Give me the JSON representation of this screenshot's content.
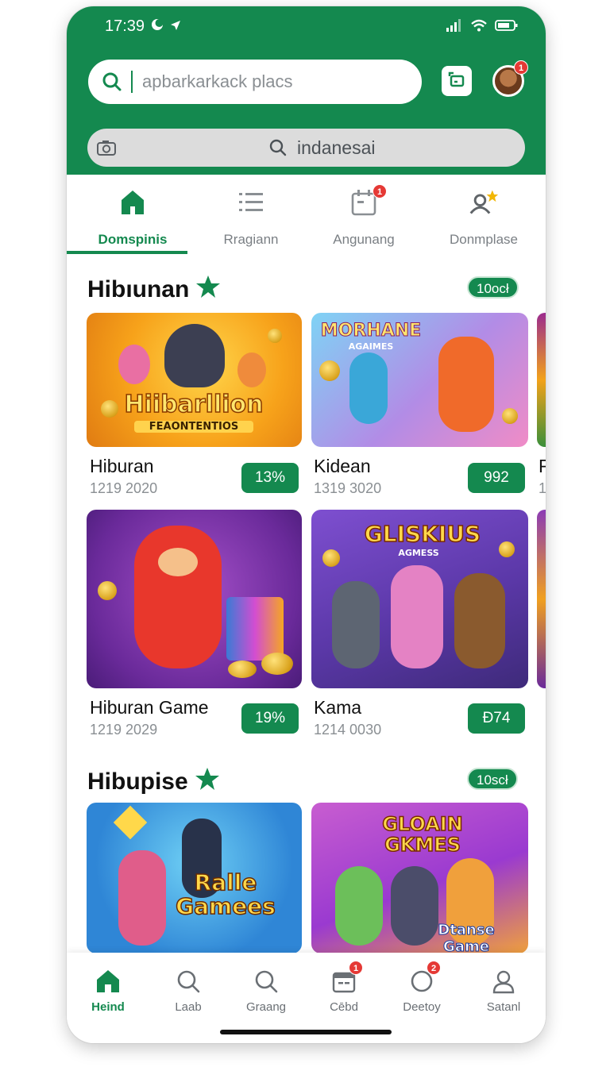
{
  "status_bar": {
    "time": "17:39"
  },
  "search": {
    "placeholder": "apbarkarkack placs"
  },
  "secondary_search": {
    "text": "indanesai"
  },
  "profile": {
    "badge": "1"
  },
  "tabs": [
    {
      "label": "Domspinis",
      "active": true
    },
    {
      "label": "Rragiann",
      "active": false
    },
    {
      "label": "Angunang",
      "active": false,
      "badge": "1"
    },
    {
      "label": "Donmplase",
      "active": false
    }
  ],
  "sections": [
    {
      "title": "Hibıunan",
      "pill": "10ocł",
      "cards": [
        {
          "name": "Hiburan",
          "sub": "1219 2020",
          "pill": "13%",
          "art_title": "Hiibarllion",
          "art_sub": "FEAONTENTIOS"
        },
        {
          "name": "Kidean",
          "sub": "1319 3020",
          "pill": "992",
          "art_title": "MORHANE",
          "art_sub": "AGAIMES"
        },
        {
          "name": "Hiburan Game",
          "sub": "1219 2029",
          "pill": "19%",
          "art_title": "",
          "art_sub": ""
        },
        {
          "name": "Kama",
          "sub": "1214 0030",
          "pill": "Ð74",
          "art_title": "GLISKIUS",
          "art_sub": "AGMESS"
        }
      ],
      "peek_text": [
        "F",
        "1"
      ]
    },
    {
      "title": "Hibupise",
      "pill": "10scł",
      "cards": [
        {
          "art_title": "Ralle Gamees"
        },
        {
          "art_title": "GLOAIN GKMES",
          "art_sub": "Dtanse Game"
        }
      ]
    }
  ],
  "bottom_nav": [
    {
      "label": "Heind",
      "icon": "home-icon",
      "active": true
    },
    {
      "label": "Laab",
      "icon": "search-icon",
      "active": false
    },
    {
      "label": "Graang",
      "icon": "search-alt-icon",
      "active": false
    },
    {
      "label": "Cēbd",
      "icon": "calendar-icon",
      "active": false,
      "badge": "1"
    },
    {
      "label": "Deetoy",
      "icon": "circle-icon",
      "active": false,
      "badge": "2"
    },
    {
      "label": "Satanl",
      "icon": "user-icon",
      "active": false
    }
  ],
  "colors": {
    "brand_green": "#14894f",
    "badge_red": "#e53935"
  }
}
